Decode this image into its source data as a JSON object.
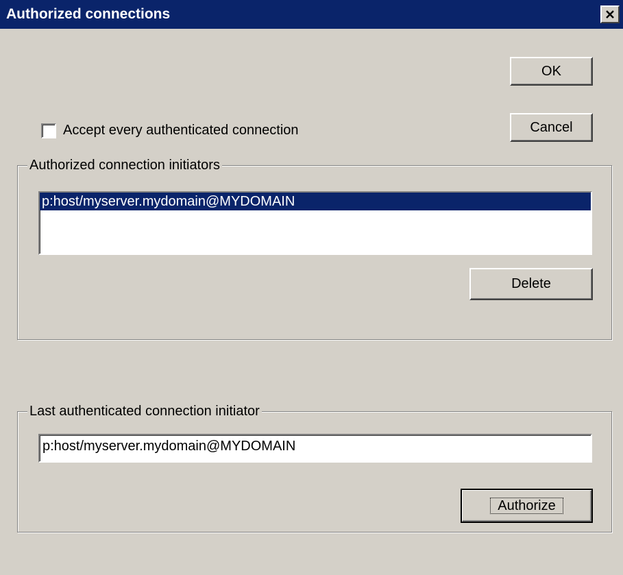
{
  "window": {
    "title": "Authorized connections",
    "close_glyph": "✕"
  },
  "buttons": {
    "ok_label": "OK",
    "cancel_label": "Cancel",
    "delete_label": "Delete",
    "authorize_label": "Authorize"
  },
  "accept_checkbox": {
    "label": "Accept every authenticated connection",
    "checked": false
  },
  "authorized_group": {
    "legend": "Authorized connection initiators",
    "items": [
      {
        "label": "p:host/myserver.mydomain@MYDOMAIN",
        "selected": true
      }
    ]
  },
  "last_group": {
    "legend": "Last authenticated connection initiator",
    "field_value": "p:host/myserver.mydomain@MYDOMAIN"
  },
  "colors": {
    "titlebar": "#0a246a",
    "face": "#d4d0c8",
    "selection": "#0a246a"
  }
}
